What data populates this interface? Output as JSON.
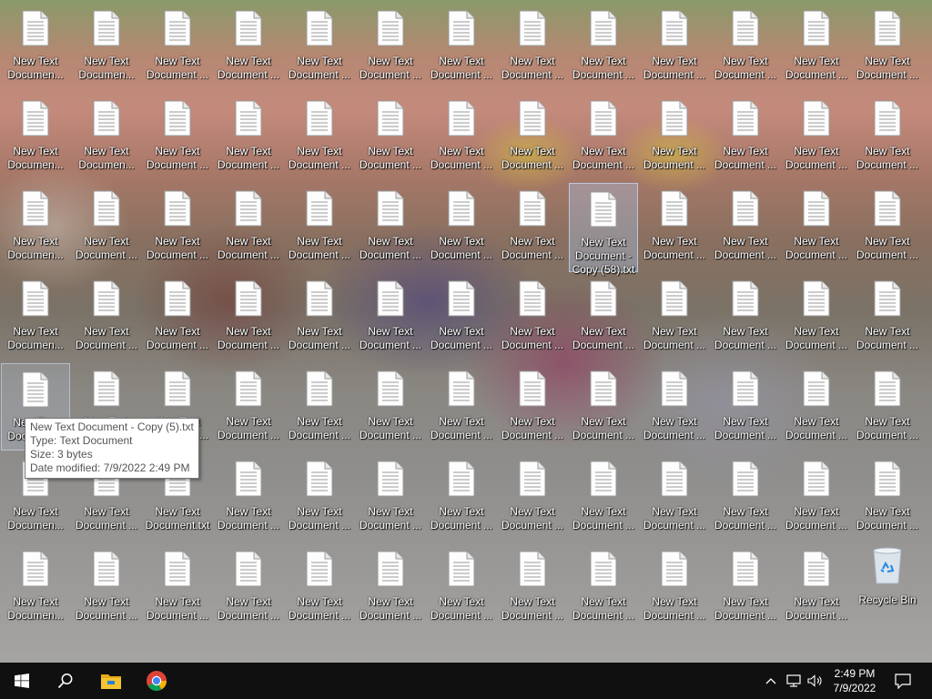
{
  "desktop": {
    "rows": [
      [
        {
          "line1": "New Text",
          "line2": "Documen..."
        },
        {
          "line1": "New Text",
          "line2": "Documen..."
        },
        {
          "line1": "New Text",
          "line2": "Document ..."
        },
        {
          "line1": "New Text",
          "line2": "Document ..."
        },
        {
          "line1": "New Text",
          "line2": "Document ..."
        },
        {
          "line1": "New Text",
          "line2": "Document ..."
        },
        {
          "line1": "New Text",
          "line2": "Document ..."
        },
        {
          "line1": "New Text",
          "line2": "Document ..."
        },
        {
          "line1": "New Text",
          "line2": "Document ..."
        },
        {
          "line1": "New Text",
          "line2": "Document ..."
        },
        {
          "line1": "New Text",
          "line2": "Document ..."
        },
        {
          "line1": "New Text",
          "line2": "Document ..."
        },
        {
          "line1": "New Text",
          "line2": "Document ..."
        }
      ],
      [
        {
          "line1": "New Text",
          "line2": "Documen..."
        },
        {
          "line1": "New Text",
          "line2": "Documen..."
        },
        {
          "line1": "New Text",
          "line2": "Document ..."
        },
        {
          "line1": "New Text",
          "line2": "Document ..."
        },
        {
          "line1": "New Text",
          "line2": "Document ..."
        },
        {
          "line1": "New Text",
          "line2": "Document ..."
        },
        {
          "line1": "New Text",
          "line2": "Document ..."
        },
        {
          "line1": "New Text",
          "line2": "Document ..."
        },
        {
          "line1": "New Text",
          "line2": "Document ..."
        },
        {
          "line1": "New Text",
          "line2": "Document ..."
        },
        {
          "line1": "New Text",
          "line2": "Document ..."
        },
        {
          "line1": "New Text",
          "line2": "Document ..."
        },
        {
          "line1": "New Text",
          "line2": "Document ..."
        }
      ],
      [
        {
          "line1": "New Text",
          "line2": "Documen..."
        },
        {
          "line1": "New Text",
          "line2": "Document ..."
        },
        {
          "line1": "New Text",
          "line2": "Document ..."
        },
        {
          "line1": "New Text",
          "line2": "Document ..."
        },
        {
          "line1": "New Text",
          "line2": "Document ..."
        },
        {
          "line1": "New Text",
          "line2": "Document ..."
        },
        {
          "line1": "New Text",
          "line2": "Document ..."
        },
        {
          "line1": "New Text",
          "line2": "Document ..."
        },
        {
          "line1": "New Text",
          "line2": "Document -",
          "line3": "Copy (58).txt",
          "selected": true
        },
        {
          "line1": "New Text",
          "line2": "Document ..."
        },
        {
          "line1": "New Text",
          "line2": "Document ..."
        },
        {
          "line1": "New Text",
          "line2": "Document ..."
        },
        {
          "line1": "New Text",
          "line2": "Document ..."
        }
      ],
      [
        {
          "line1": "New Text",
          "line2": "Documen..."
        },
        {
          "line1": "New Text",
          "line2": "Document ..."
        },
        {
          "line1": "New Text",
          "line2": "Document ..."
        },
        {
          "line1": "New Text",
          "line2": "Document ..."
        },
        {
          "line1": "New Text",
          "line2": "Document ..."
        },
        {
          "line1": "New Text",
          "line2": "Document ..."
        },
        {
          "line1": "New Text",
          "line2": "Document ..."
        },
        {
          "line1": "New Text",
          "line2": "Document ..."
        },
        {
          "line1": "New Text",
          "line2": "Document ..."
        },
        {
          "line1": "New Text",
          "line2": "Document ..."
        },
        {
          "line1": "New Text",
          "line2": "Document ..."
        },
        {
          "line1": "New Text",
          "line2": "Document ..."
        },
        {
          "line1": "New Text",
          "line2": "Document ..."
        }
      ],
      [
        {
          "line1": "New Text",
          "line2": "Documen...",
          "hovered": true
        },
        {
          "line1": "New Text",
          "line2": "Document ..."
        },
        {
          "line1": "New Text",
          "line2": "Document ..."
        },
        {
          "line1": "New Text",
          "line2": "Document ..."
        },
        {
          "line1": "New Text",
          "line2": "Document ..."
        },
        {
          "line1": "New Text",
          "line2": "Document ..."
        },
        {
          "line1": "New Text",
          "line2": "Document ..."
        },
        {
          "line1": "New Text",
          "line2": "Document ..."
        },
        {
          "line1": "New Text",
          "line2": "Document ..."
        },
        {
          "line1": "New Text",
          "line2": "Document ..."
        },
        {
          "line1": "New Text",
          "line2": "Document ..."
        },
        {
          "line1": "New Text",
          "line2": "Document ..."
        },
        {
          "line1": "New Text",
          "line2": "Document ..."
        }
      ],
      [
        {
          "line1": "New Text",
          "line2": "Documen..."
        },
        {
          "line1": "New Text",
          "line2": "Document ..."
        },
        {
          "line1": "New Text",
          "line2": "Document.txt"
        },
        {
          "line1": "New Text",
          "line2": "Document ..."
        },
        {
          "line1": "New Text",
          "line2": "Document ..."
        },
        {
          "line1": "New Text",
          "line2": "Document ..."
        },
        {
          "line1": "New Text",
          "line2": "Document ..."
        },
        {
          "line1": "New Text",
          "line2": "Document ..."
        },
        {
          "line1": "New Text",
          "line2": "Document ..."
        },
        {
          "line1": "New Text",
          "line2": "Document ..."
        },
        {
          "line1": "New Text",
          "line2": "Document ..."
        },
        {
          "line1": "New Text",
          "line2": "Document ..."
        },
        {
          "line1": "New Text",
          "line2": "Document ..."
        }
      ],
      [
        {
          "line1": "New Text",
          "line2": "Documen..."
        },
        {
          "line1": "New Text",
          "line2": "Document ..."
        },
        {
          "line1": "New Text",
          "line2": "Document ..."
        },
        {
          "line1": "New Text",
          "line2": "Document ..."
        },
        {
          "line1": "New Text",
          "line2": "Document ..."
        },
        {
          "line1": "New Text",
          "line2": "Document ..."
        },
        {
          "line1": "New Text",
          "line2": "Document ..."
        },
        {
          "line1": "New Text",
          "line2": "Document ..."
        },
        {
          "line1": "New Text",
          "line2": "Document ..."
        },
        {
          "line1": "New Text",
          "line2": "Document ..."
        },
        {
          "line1": "New Text",
          "line2": "Document ..."
        },
        {
          "line1": "New Text",
          "line2": "Document ..."
        },
        {
          "line1": "Recycle Bin",
          "recycle": true
        }
      ]
    ]
  },
  "tooltip": {
    "name": "New Text Document - Copy (5).txt",
    "type": "Type: Text Document",
    "size": "Size: 3 bytes",
    "modified": "Date modified: 7/9/2022 2:49 PM"
  },
  "taskbar": {
    "start_icon": "windows-logo-icon",
    "search_icon": "search-icon",
    "pinned": [
      "file-explorer-icon",
      "chrome-icon"
    ],
    "tray_icons": [
      "chevron-up-icon",
      "network-icon",
      "volume-icon"
    ],
    "time": "2:49 PM",
    "date": "7/9/2022",
    "notification_icon": "action-center-icon"
  },
  "colors": {
    "taskbar_bg": "#101010",
    "selection_bg": "#aac8f0",
    "explorer_yellow": "#f4c430",
    "chrome_red": "#db4437",
    "chrome_green": "#0f9d58",
    "chrome_yellow": "#f4b400",
    "chrome_blue": "#4285f4"
  }
}
